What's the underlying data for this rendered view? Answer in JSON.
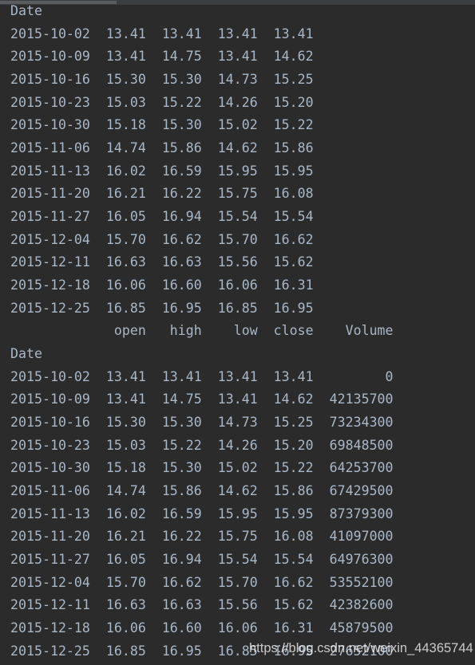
{
  "index_name": "Date",
  "table1": {
    "rows": [
      [
        "2015-10-02",
        "13.41",
        "13.41",
        "13.41",
        "13.41"
      ],
      [
        "2015-10-09",
        "13.41",
        "14.75",
        "13.41",
        "14.62"
      ],
      [
        "2015-10-16",
        "15.30",
        "15.30",
        "14.73",
        "15.25"
      ],
      [
        "2015-10-23",
        "15.03",
        "15.22",
        "14.26",
        "15.20"
      ],
      [
        "2015-10-30",
        "15.18",
        "15.30",
        "15.02",
        "15.22"
      ],
      [
        "2015-11-06",
        "14.74",
        "15.86",
        "14.62",
        "15.86"
      ],
      [
        "2015-11-13",
        "16.02",
        "16.59",
        "15.95",
        "15.95"
      ],
      [
        "2015-11-20",
        "16.21",
        "16.22",
        "15.75",
        "16.08"
      ],
      [
        "2015-11-27",
        "16.05",
        "16.94",
        "15.54",
        "15.54"
      ],
      [
        "2015-12-04",
        "15.70",
        "16.62",
        "15.70",
        "16.62"
      ],
      [
        "2015-12-11",
        "16.63",
        "16.63",
        "15.56",
        "15.62"
      ],
      [
        "2015-12-18",
        "16.06",
        "16.60",
        "16.06",
        "16.31"
      ],
      [
        "2015-12-25",
        "16.85",
        "16.95",
        "16.85",
        "16.95"
      ]
    ]
  },
  "table2": {
    "columns": [
      "open",
      "high",
      "low",
      "close",
      "Volume"
    ],
    "rows": [
      [
        "2015-10-02",
        "13.41",
        "13.41",
        "13.41",
        "13.41",
        "0"
      ],
      [
        "2015-10-09",
        "13.41",
        "14.75",
        "13.41",
        "14.62",
        "42135700"
      ],
      [
        "2015-10-16",
        "15.30",
        "15.30",
        "14.73",
        "15.25",
        "73234300"
      ],
      [
        "2015-10-23",
        "15.03",
        "15.22",
        "14.26",
        "15.20",
        "69848500"
      ],
      [
        "2015-10-30",
        "15.18",
        "15.30",
        "15.02",
        "15.22",
        "64253700"
      ],
      [
        "2015-11-06",
        "14.74",
        "15.86",
        "14.62",
        "15.86",
        "67429500"
      ],
      [
        "2015-11-13",
        "16.02",
        "16.59",
        "15.95",
        "15.95",
        "87379300"
      ],
      [
        "2015-11-20",
        "16.21",
        "16.22",
        "15.75",
        "16.08",
        "41097000"
      ],
      [
        "2015-11-27",
        "16.05",
        "16.94",
        "15.54",
        "15.54",
        "64976300"
      ],
      [
        "2015-12-04",
        "15.70",
        "16.62",
        "15.70",
        "16.62",
        "53552100"
      ],
      [
        "2015-12-11",
        "16.63",
        "16.63",
        "15.56",
        "15.62",
        "42382600"
      ],
      [
        "2015-12-18",
        "16.06",
        "16.60",
        "16.06",
        "16.31",
        "45879500"
      ],
      [
        "2015-12-25",
        "16.85",
        "16.95",
        "16.85",
        "16.95",
        "27652100"
      ]
    ]
  },
  "watermark": "https://blog.csdn.net/weixin_44365744"
}
